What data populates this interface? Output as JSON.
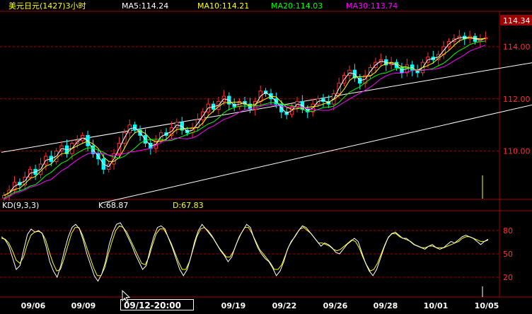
{
  "header": {
    "title": "美元日元(1427)3小时",
    "ma5": "MA5:114.24",
    "ma10": "MA10:114.21",
    "ma20": "MA20:114.03",
    "ma30": "MA30:113.74"
  },
  "kd_header": {
    "name": "KD(9,3,3)",
    "k": "K:68.87",
    "d": "D:67.83"
  },
  "price_tag": "114.34",
  "cursor_label": "09/12-20:00",
  "colors": {
    "background": "#000000",
    "up_candle": "#ff3030",
    "down_candle": "#00ffff",
    "ma5": "#ffffff",
    "ma10": "#ffff00",
    "ma20": "#00ff00",
    "ma30": "#ff00ff",
    "grid": "#a00000",
    "axis_text": "#ff3030",
    "header_text": "#ffff00"
  },
  "chart_data": [
    {
      "type": "candlestick",
      "title": "美元日元(1427)3小时",
      "y_ticks": [
        "114.00",
        "112.00",
        "110.00"
      ],
      "ylim": [
        108.2,
        115.3
      ],
      "last_price": 114.34,
      "x_ticks": [
        "09/06",
        "09/09",
        "09/12",
        "09/19",
        "09/22",
        "09/26",
        "09/28",
        "10/01",
        "10/05"
      ],
      "moving_averages": [
        {
          "name": "MA5",
          "last": 114.24
        },
        {
          "name": "MA10",
          "last": 114.21
        },
        {
          "name": "MA20",
          "last": 114.03
        },
        {
          "name": "MA30",
          "last": 113.74
        }
      ],
      "channel": {
        "upper": [
          [
            0,
            109.95
          ],
          [
            147,
            115.0
          ]
        ],
        "lower": [
          [
            19,
            108.0
          ],
          [
            147,
            113.95
          ]
        ]
      },
      "close": [
        108.3,
        108.5,
        108.8,
        108.7,
        109.0,
        109.3,
        109.1,
        109.5,
        109.8,
        109.6,
        110.0,
        110.2,
        109.9,
        110.3,
        110.4,
        110.6,
        110.2,
        109.9,
        109.7,
        109.3,
        109.5,
        109.9,
        110.3,
        110.7,
        111.0,
        110.8,
        110.6,
        110.3,
        110.1,
        110.4,
        110.7,
        110.6,
        110.9,
        111.1,
        110.8,
        110.7,
        110.9,
        111.2,
        111.5,
        111.8,
        111.6,
        111.9,
        112.1,
        111.8,
        111.7,
        111.9,
        111.8,
        111.6,
        111.9,
        112.3,
        112.2,
        112.0,
        111.8,
        111.5,
        111.4,
        111.7,
        111.9,
        111.6,
        111.5,
        111.8,
        112.0,
        111.9,
        111.8,
        112.2,
        112.6,
        112.9,
        113.1,
        112.8,
        112.6,
        112.9,
        113.2,
        113.4,
        113.5,
        113.3,
        113.4,
        113.2,
        113.0,
        113.3,
        113.1,
        113.0,
        113.4,
        113.6,
        113.5,
        113.7,
        114.0,
        114.2,
        114.3,
        114.4,
        114.3,
        114.4,
        114.2,
        114.3,
        114.34
      ],
      "oscillator": {
        "name": "KD(9,3,3)",
        "k_last": 68.87,
        "d_last": 67.83,
        "y_ticks": [
          80,
          50,
          20
        ],
        "k": [
          72,
          68,
          60,
          45,
          30,
          35,
          55,
          75,
          82,
          78,
          80,
          76,
          60,
          40,
          28,
          20,
          35,
          55,
          72,
          84,
          88,
          82,
          68,
          50,
          36,
          22,
          15,
          24,
          40,
          62,
          78,
          88,
          90,
          82,
          72,
          62,
          50,
          40,
          30,
          35,
          55,
          72,
          84,
          86,
          82,
          70,
          58,
          44,
          30,
          22,
          30,
          46,
          66,
          80,
          88,
          82,
          76,
          70,
          62,
          54,
          48,
          40,
          46,
          60,
          72,
          80,
          88,
          84,
          70,
          58,
          50,
          44,
          40,
          32,
          22,
          28,
          40,
          56,
          66,
          72,
          80,
          86,
          84,
          78,
          72,
          66,
          60,
          64,
          62,
          58,
          52,
          50,
          56,
          62,
          66,
          70,
          66,
          52,
          38,
          28,
          22,
          30,
          44,
          58,
          70,
          76,
          78,
          74,
          70,
          70,
          66,
          62,
          60,
          58,
          56,
          60,
          62,
          58,
          56,
          58,
          62,
          66,
          64,
          68,
          72,
          74,
          72,
          70,
          66,
          62,
          66,
          68.87
        ],
        "d": [
          70,
          69,
          64,
          54,
          42,
          38,
          46,
          62,
          74,
          78,
          79,
          77,
          68,
          52,
          38,
          28,
          30,
          44,
          60,
          76,
          84,
          84,
          74,
          60,
          46,
          32,
          22,
          22,
          32,
          50,
          66,
          80,
          86,
          84,
          78,
          68,
          58,
          48,
          38,
          36,
          46,
          62,
          76,
          82,
          82,
          74,
          64,
          52,
          40,
          30,
          30,
          40,
          56,
          72,
          82,
          84,
          80,
          74,
          66,
          58,
          52,
          46,
          46,
          54,
          66,
          76,
          84,
          84,
          76,
          66,
          56,
          50,
          44,
          38,
          30,
          30,
          36,
          48,
          60,
          68,
          76,
          82,
          84,
          80,
          76,
          70,
          64,
          64,
          62,
          60,
          56,
          54,
          56,
          60,
          64,
          68,
          66,
          58,
          46,
          36,
          28,
          30,
          38,
          50,
          62,
          72,
          76,
          76,
          72,
          70,
          68,
          66,
          62,
          60,
          58,
          58,
          60,
          60,
          58,
          58,
          58,
          60,
          62,
          64,
          66,
          70,
          72,
          72,
          70,
          68,
          66,
          66,
          67.83
        ]
      }
    }
  ]
}
